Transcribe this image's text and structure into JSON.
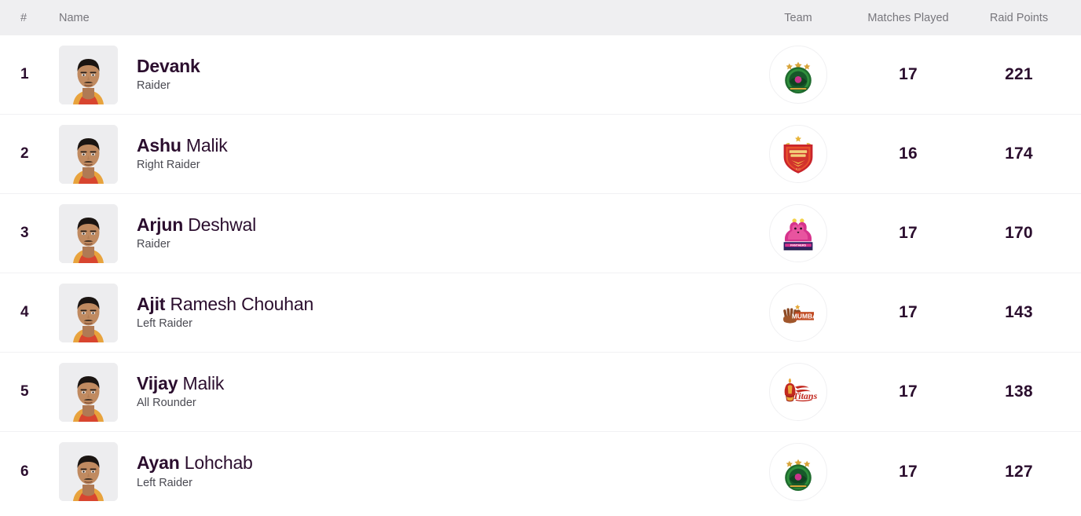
{
  "header": {
    "rank_label": "#",
    "name_label": "Name",
    "team_label": "Team",
    "matches_label": "Matches Played",
    "raid_points_label": "Raid Points"
  },
  "colors": {
    "header_bg": "#efeff1",
    "header_text": "#77767c",
    "name_text": "#2b0e2e",
    "role_text": "#4a4a52",
    "row_divider": "#f1f1f3",
    "row_bg": "#ffffff"
  },
  "rows": [
    {
      "rank": "1",
      "first_name": "Devank",
      "last_name": "",
      "role": "Raider",
      "team": "Patna Pirates",
      "team_icon": "patna-pirates-logo",
      "matches_played": "17",
      "raid_points": "221"
    },
    {
      "rank": "2",
      "first_name": "Ashu",
      "last_name": "Malik",
      "role": "Right Raider",
      "team": "Dabang Delhi",
      "team_icon": "dabang-delhi-logo",
      "matches_played": "16",
      "raid_points": "174"
    },
    {
      "rank": "3",
      "first_name": "Arjun",
      "last_name": "Deshwal",
      "role": "Raider",
      "team": "Jaipur Pink Panthers",
      "team_icon": "jaipur-pink-panthers-logo",
      "matches_played": "17",
      "raid_points": "170"
    },
    {
      "rank": "4",
      "first_name": "Ajit",
      "last_name": "Ramesh Chouhan",
      "role": "Left Raider",
      "team": "U Mumba",
      "team_icon": "u-mumba-logo",
      "matches_played": "17",
      "raid_points": "143"
    },
    {
      "rank": "5",
      "first_name": "Vijay",
      "last_name": "Malik",
      "role": "All Rounder",
      "team": "Telugu Titans",
      "team_icon": "telugu-titans-logo",
      "matches_played": "17",
      "raid_points": "138"
    },
    {
      "rank": "6",
      "first_name": "Ayan",
      "last_name": "Lohchab",
      "role": "Left Raider",
      "team": "Patna Pirates",
      "team_icon": "patna-pirates-logo",
      "matches_played": "17",
      "raid_points": "127"
    }
  ]
}
